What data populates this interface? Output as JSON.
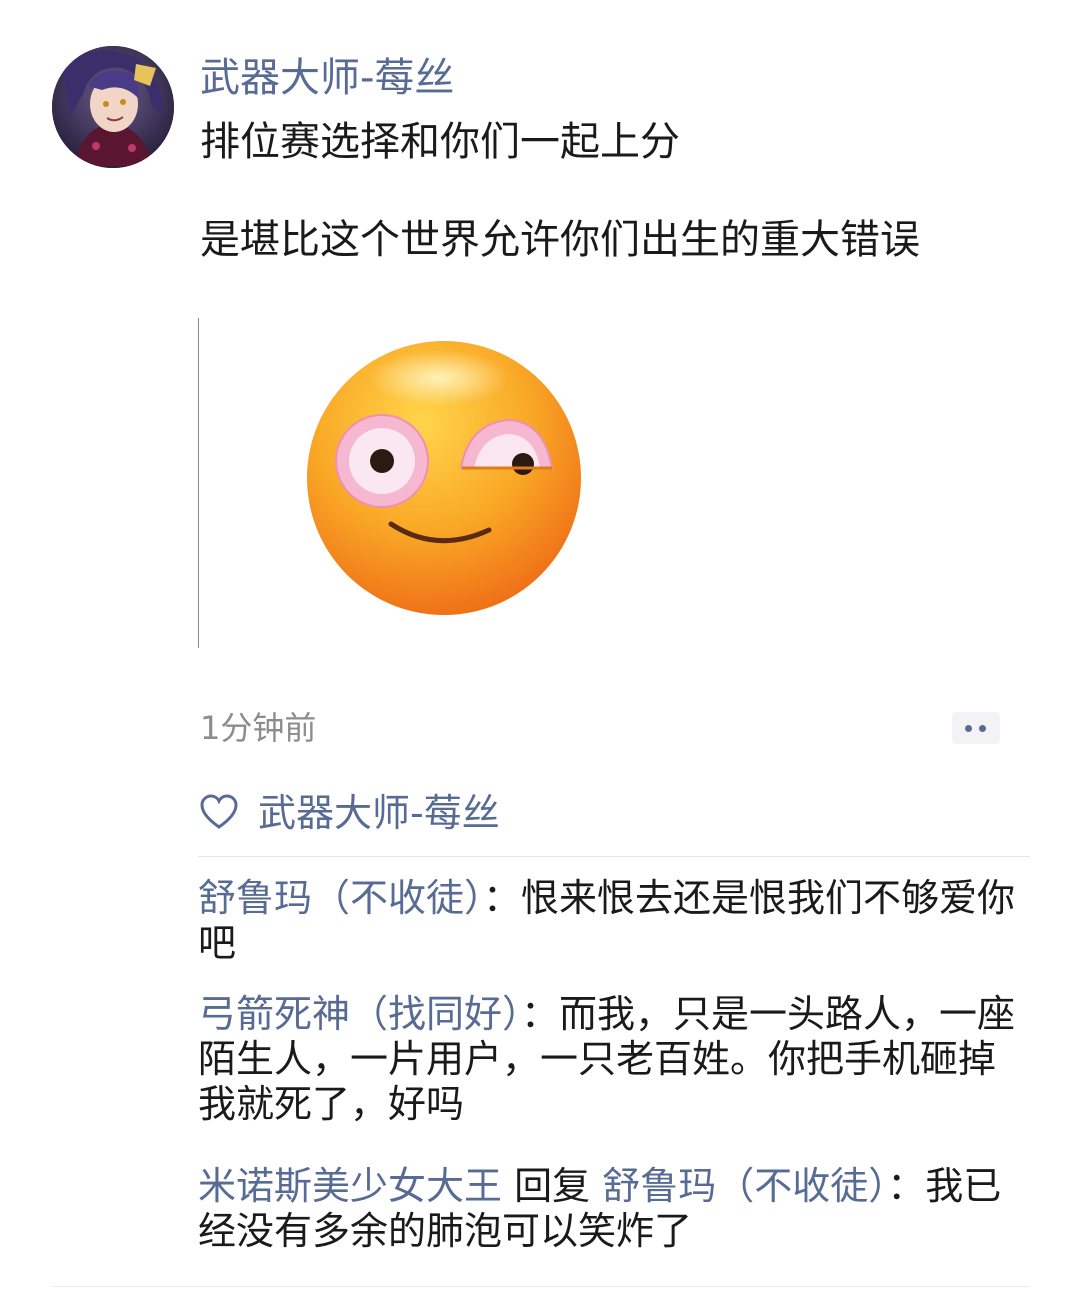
{
  "post": {
    "author": "武器大师-莓丝",
    "text_line_1": "排位赛选择和你们一起上分",
    "text_line_2": "是堪比这个世界允许你们出生的重大错误",
    "image_icon": "smirking-flushed-emoji-icon",
    "timestamp": "1分钟前"
  },
  "likes": {
    "icon": "heart-outline-icon",
    "names": "武器大师-莓丝"
  },
  "comments": [
    {
      "author": "舒鲁玛（不收徒）",
      "separator": "：",
      "text": "恨来恨去还是恨我们不够爱你吧"
    },
    {
      "author": "弓箭死神（找同好）",
      "separator": "：",
      "text": "而我，只是一头路人，一座陌生人，一片用户，一只老百姓。你把手机砸掉我就死了，好吗"
    },
    {
      "author": "米诺斯美少女大王",
      "reply_word": " 回复 ",
      "reply_to": "舒鲁玛（不收徒）",
      "separator": "：",
      "text": "我已经没有多余的肺泡可以笑炸了"
    }
  ],
  "colors": {
    "link": "#576b95",
    "text": "#1a1a1a",
    "muted": "#8c8c8c",
    "emoji_face": "#f7a81c",
    "emoji_eye": "#f0a6c4"
  }
}
